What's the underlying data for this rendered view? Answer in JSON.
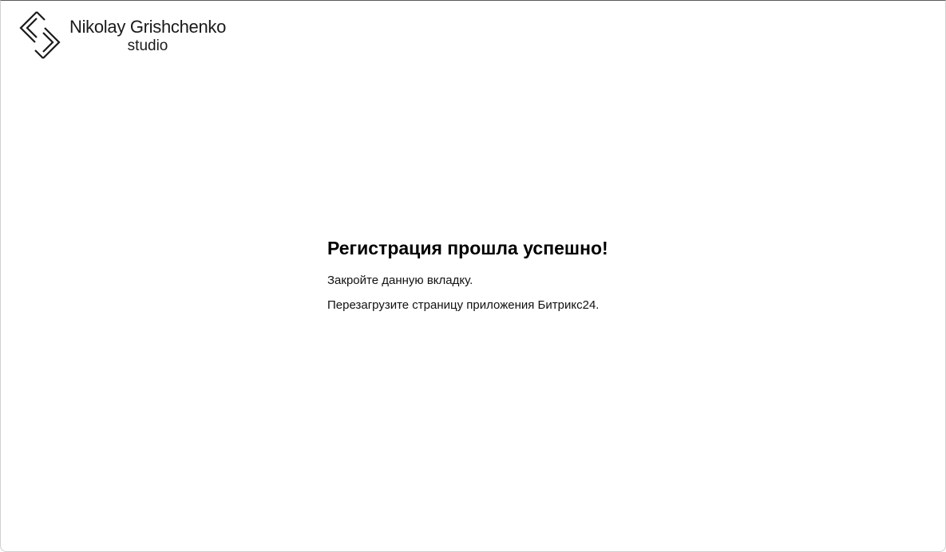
{
  "brand": {
    "name": "Nikolay Grishchenko",
    "subtitle": "studio",
    "logo_icon": "diamond-chevrons-logo-icon"
  },
  "message": {
    "title": "Регистрация прошла успешно!",
    "lines": [
      "Закройте данную вкладку.",
      "Перезагрузите страницу приложения Битрикс24."
    ]
  },
  "colors": {
    "text": "#000000",
    "logo": "#1a1a1a",
    "background": "#ffffff"
  }
}
